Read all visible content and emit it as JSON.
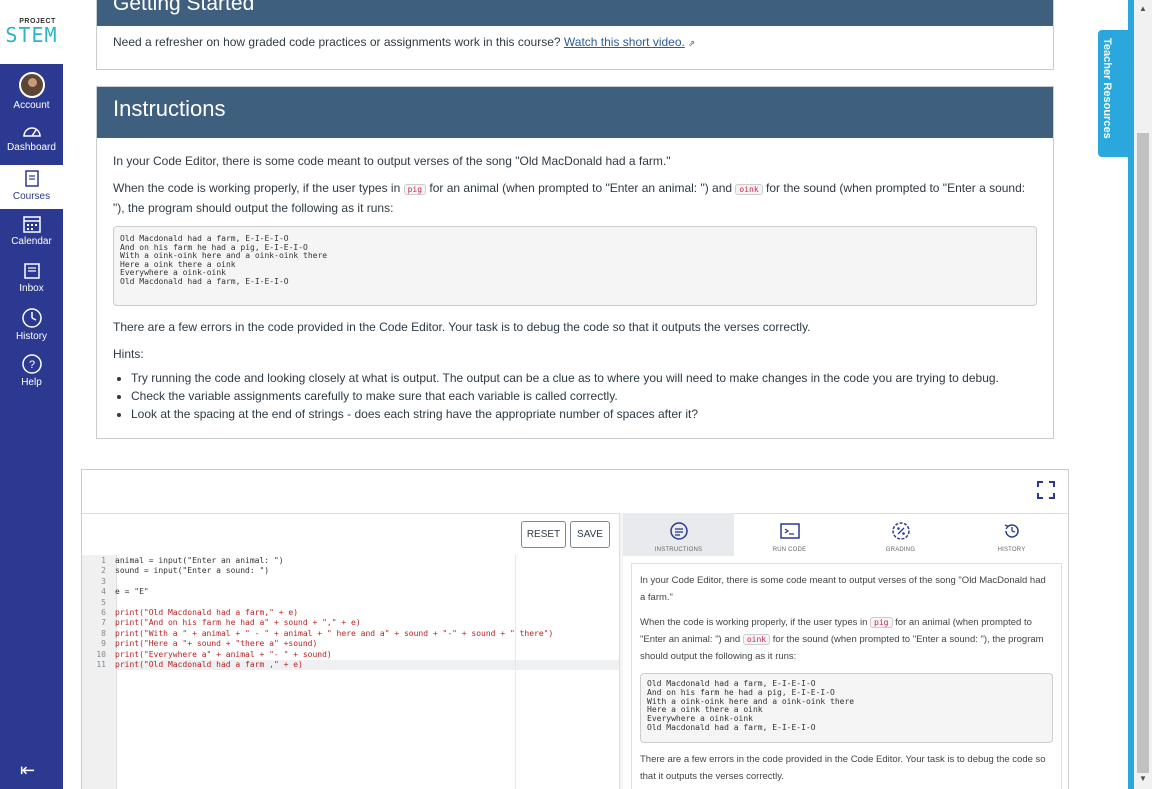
{
  "logo": {
    "small": "PROJECT",
    "big": "STEM"
  },
  "nav": {
    "items": [
      {
        "label": "Account",
        "icon": "avatar"
      },
      {
        "label": "Dashboard",
        "icon": "dashboard-icon"
      },
      {
        "label": "Courses",
        "icon": "courses-icon"
      },
      {
        "label": "Calendar",
        "icon": "calendar-icon"
      },
      {
        "label": "Inbox",
        "icon": "inbox-icon"
      },
      {
        "label": "History",
        "icon": "history-icon"
      },
      {
        "label": "Help",
        "icon": "help-icon"
      }
    ],
    "collapse_icon": "⇤"
  },
  "getting_started": {
    "title": "Getting Started",
    "text": "Need a refresher on how graded code practices or assignments work in this course?",
    "link": "Watch this short video."
  },
  "instructions": {
    "title": "Instructions",
    "p1": "In your Code Editor, there is some code meant to output verses of the song \"Old MacDonald had a farm.\"",
    "p2_a": "When the code is working properly, if the user types in",
    "code_pig": "pig",
    "p2_b": "for an animal (when prompted to \"Enter an animal: \") and",
    "code_oink": "oink",
    "p2_c": "for the sound (when prompted to \"Enter a sound: \"), the program should output the following as it runs:",
    "output": "Old Macdonald had a farm, E-I-E-I-O\nAnd on his farm he had a pig, E-I-E-I-O\nWith a oink-oink here and a oink-oink there\nHere a oink there a oink\nEverywhere a oink-oink\nOld Macdonald had a farm, E-I-E-I-O",
    "p3": "There are a few errors in the code provided in the Code Editor. Your task is to debug the code so that it outputs the verses correctly.",
    "hints_title": "Hints:",
    "hints": [
      "Try running the code and looking closely at what is output.  The output can be a clue as to where you will need to make changes in the code you are trying to debug.",
      "Check the variable assignments carefully to make sure that each variable is called correctly.",
      "Look at the spacing at the end of strings - does each string have the appropriate number of spaces after it?"
    ]
  },
  "editor": {
    "reset_label": "RESET",
    "save_label": "SAVE",
    "lines": [
      {
        "n": "1",
        "code": "animal = input(\"Enter an animal: \")"
      },
      {
        "n": "2",
        "code": "sound = input(\"Enter a sound: \")"
      },
      {
        "n": "3",
        "code": ""
      },
      {
        "n": "4",
        "code": "e = \"E\""
      },
      {
        "n": "5",
        "code": ""
      },
      {
        "n": "6",
        "code": "print(\"Old Macdonald had a farm,\" + e)"
      },
      {
        "n": "7",
        "code": "print(\"And on his farm he had a\" + sound + \",\" + e)"
      },
      {
        "n": "8",
        "code": "print(\"With a \" + animal + \" - \" + animal + \" here and a\" + sound + \"-\" + sound + \" there\")"
      },
      {
        "n": "9",
        "code": "print(\"Here a \"+ sound + \"there a\" +sound)"
      },
      {
        "n": "10",
        "code": "print(\"Everywhere a\" + animal + \"- \" + sound)"
      },
      {
        "n": "11",
        "code": "print(\"Old Macdonald had a farm ,\" + e)"
      }
    ],
    "tabs": [
      {
        "label": "INSTRUCTIONS",
        "icon": "instructions-icon"
      },
      {
        "label": "RUN CODE",
        "icon": "terminal-icon"
      },
      {
        "label": "GRADING",
        "icon": "grading-icon"
      },
      {
        "label": "HISTORY",
        "icon": "history-icon"
      }
    ],
    "pane": {
      "p1": "In your Code Editor, there is some code meant to output verses of the song \"Old MacDonald had a farm.\"",
      "p2_a": "When the code is working properly, if the user types in",
      "code_pig": "pig",
      "p2_b": "for an animal (when prompted to \"Enter an animal: \") and",
      "code_oink": "oink",
      "p2_c": "for the sound (when prompted to \"Enter a sound: \"), the program should output the following as it runs:",
      "output": "Old Macdonald had a farm, E-I-E-I-O\nAnd on his farm he had a pig, E-I-E-I-O\nWith a oink-oink here and a oink-oink there\nHere a oink there a oink\nEverywhere a oink-oink\nOld Macdonald had a farm, E-I-E-I-O",
      "p3": "There are a few errors in the code provided in the Code Editor. Your task is to debug the code so that it outputs the verses correctly."
    }
  },
  "teacher_resources": "Teacher Resources",
  "colors": {
    "nav": "#2b3990",
    "header": "#3f5f7f",
    "accent": "#2aa7dc"
  }
}
